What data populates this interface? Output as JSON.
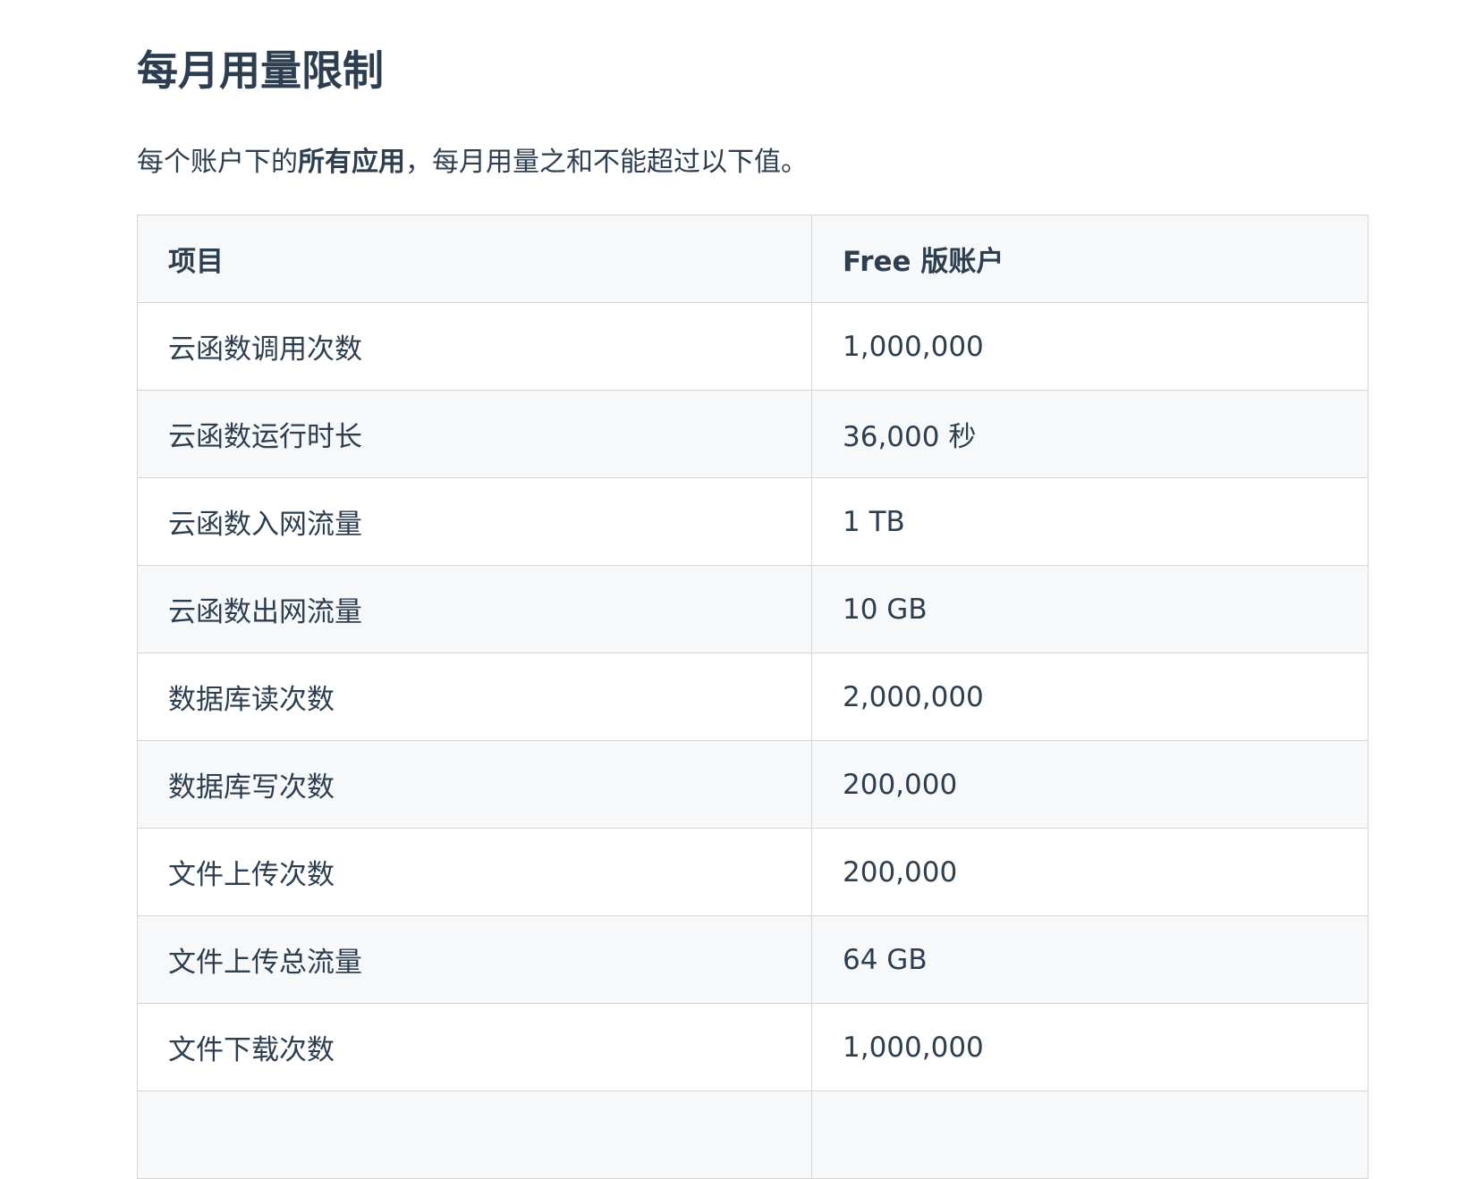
{
  "title": "每月用量限制",
  "intro": {
    "before": "每个账户下的",
    "bold": "所有应用",
    "after": "，每月用量之和不能超过以下值。"
  },
  "table": {
    "headers": [
      "项目",
      "Free 版账户"
    ],
    "rows": [
      [
        "云函数调用次数",
        "1,000,000"
      ],
      [
        "云函数运行时长",
        "36,000 秒"
      ],
      [
        "云函数入网流量",
        "1 TB"
      ],
      [
        "云函数出网流量",
        "10 GB"
      ],
      [
        "数据库读次数",
        "2,000,000"
      ],
      [
        "数据库写次数",
        "200,000"
      ],
      [
        "文件上传次数",
        "200,000"
      ],
      [
        "文件上传总流量",
        "64 GB"
      ],
      [
        "文件下载次数",
        "1,000,000"
      ],
      [
        "",
        ""
      ]
    ]
  }
}
